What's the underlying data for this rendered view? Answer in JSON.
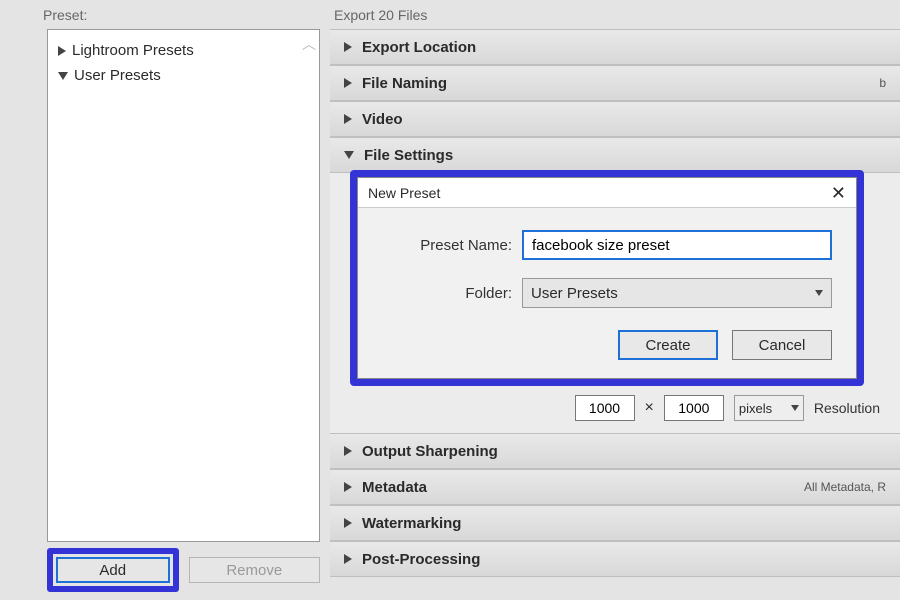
{
  "left": {
    "header": "Preset:",
    "items": [
      {
        "label": "Lightroom Presets",
        "expanded": false
      },
      {
        "label": "User Presets",
        "expanded": true
      }
    ],
    "add_label": "Add",
    "remove_label": "Remove"
  },
  "right": {
    "header": "Export 20 Files",
    "sections": {
      "export_location": "Export Location",
      "file_naming": "File Naming",
      "file_naming_meta": "b",
      "video": "Video",
      "file_settings": "File Settings",
      "output_sharpening": "Output Sharpening",
      "metadata": "Metadata",
      "metadata_meta": "All Metadata, R",
      "watermarking": "Watermarking",
      "post_processing": "Post-Processing"
    },
    "dims": {
      "w": "1000",
      "times": "×",
      "h": "1000",
      "unit": "pixels",
      "res_label": "Resolution"
    }
  },
  "dialog": {
    "title": "New Preset",
    "name_label": "Preset Name:",
    "name_value": "facebook size preset",
    "folder_label": "Folder:",
    "folder_value": "User Presets",
    "create_label": "Create",
    "cancel_label": "Cancel"
  }
}
